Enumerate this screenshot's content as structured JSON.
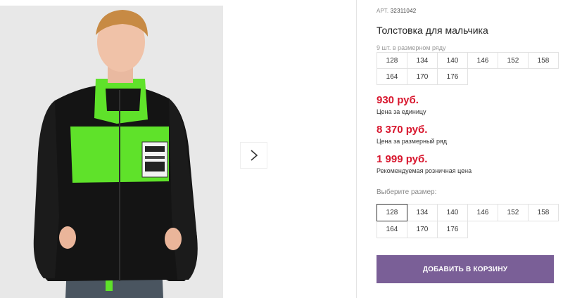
{
  "product": {
    "art_label": "АРТ.",
    "art_number": "32311042",
    "title": "Толстовка для мальчика",
    "size_row_label": "9 шт. в размерном ряду",
    "size_row": [
      "128",
      "134",
      "140",
      "146",
      "152",
      "158",
      "164",
      "170",
      "176"
    ]
  },
  "prices": {
    "unit_price": "930 руб.",
    "unit_label": "Цена за единицу",
    "row_price": "8 370 руб.",
    "row_label": "Цена за размерный ряд",
    "retail_price": "1 999 руб.",
    "retail_label": "Рекомендуемая розничная цена"
  },
  "size_picker": {
    "label": "Выберите размер:",
    "sizes": [
      "128",
      "134",
      "140",
      "146",
      "152",
      "158",
      "164",
      "170",
      "176"
    ],
    "selected": "128"
  },
  "cart": {
    "add_label": "ДОБАВИТЬ В КОРЗИНУ"
  },
  "gallery": {
    "next_icon": "chevron-right-icon",
    "image_subject": "boy-in-black-green-fleece-jacket"
  },
  "colors": {
    "price": "#d8172e",
    "button": "#7a5f97",
    "jacket_accent": "#5fe22a"
  }
}
